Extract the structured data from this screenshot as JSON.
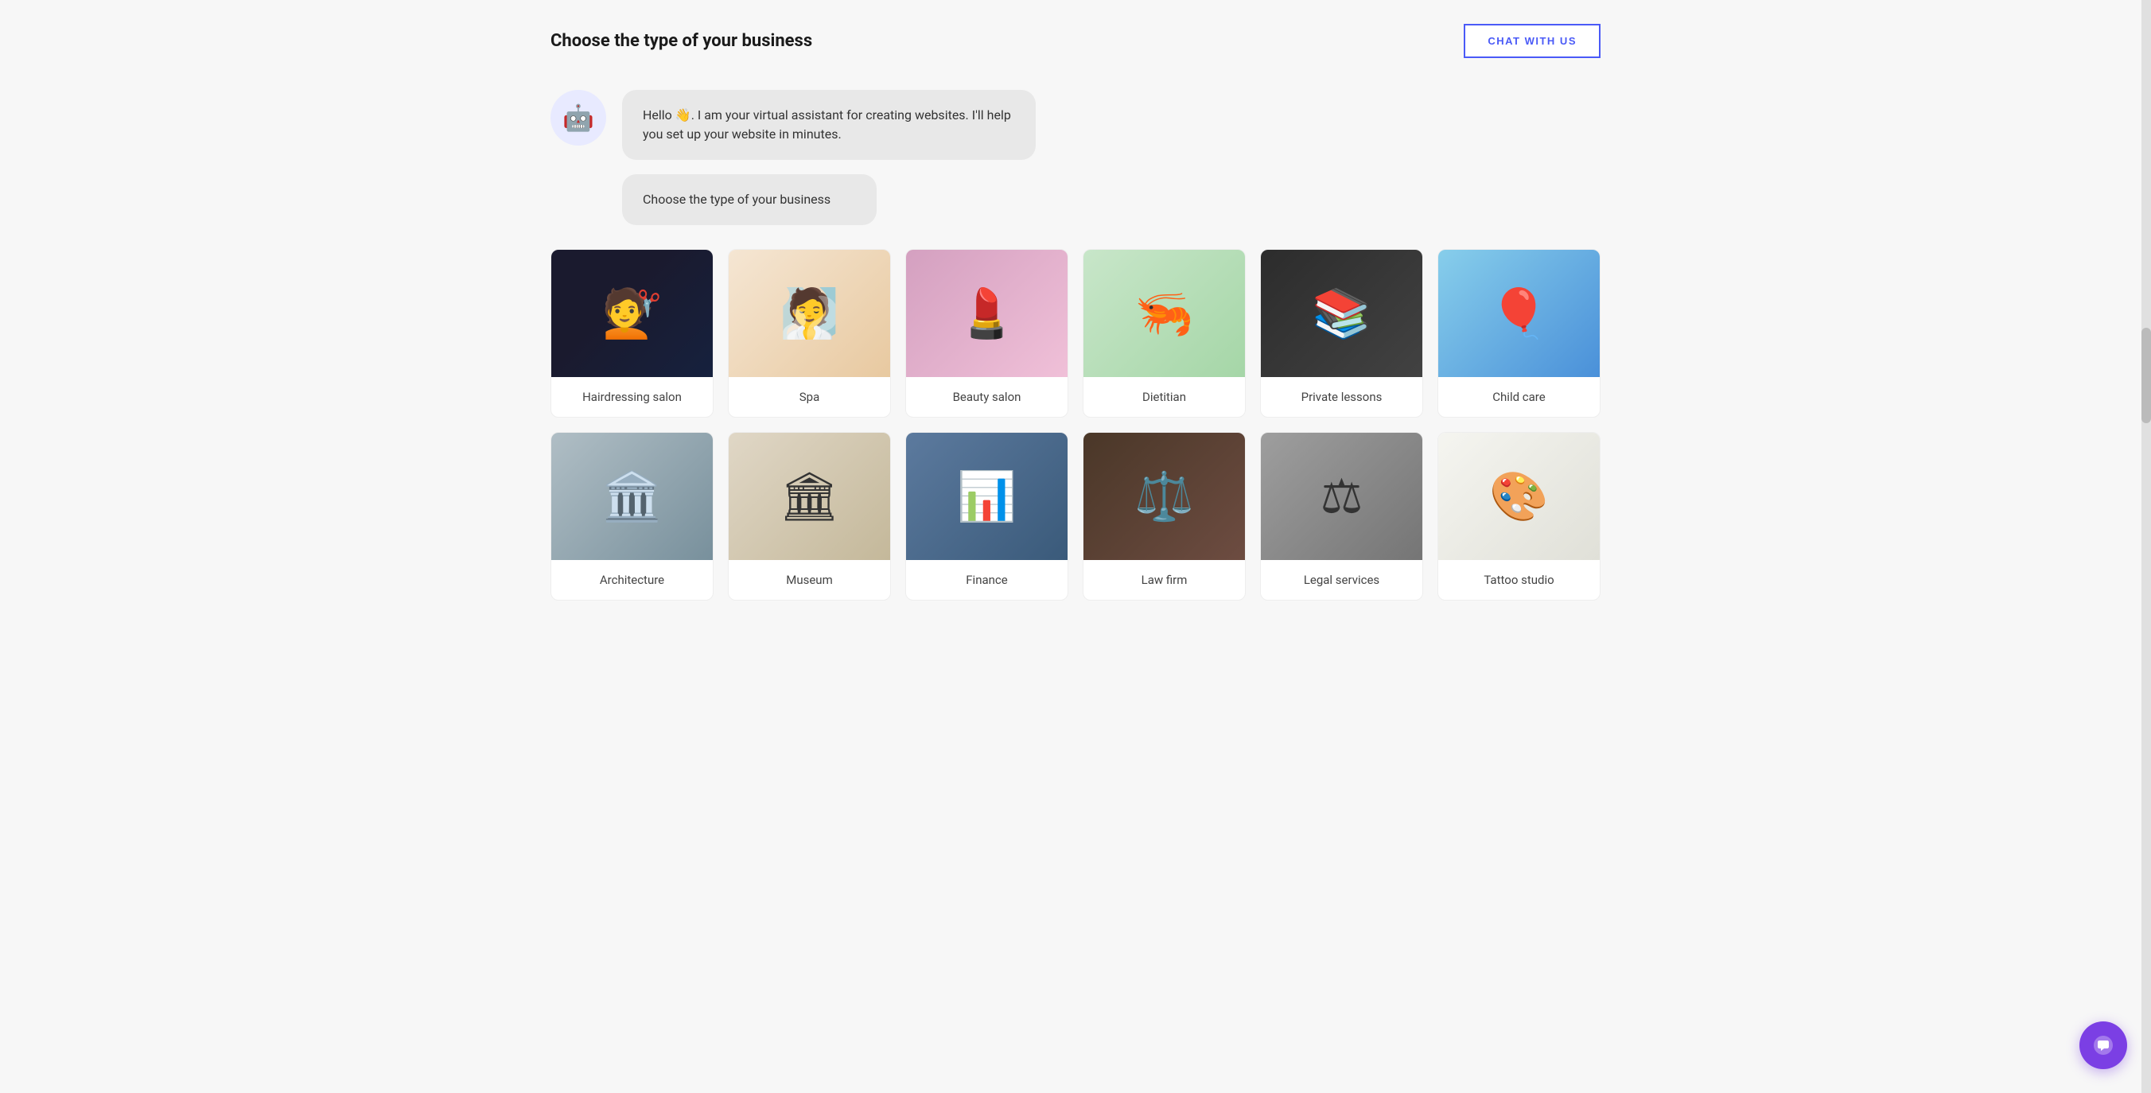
{
  "header": {
    "title": "Choose the type of your business",
    "chat_btn_label": "CHAT WITH US"
  },
  "bot": {
    "greeting_message": "Hello 👋. I am your virtual assistant for creating websites. I'll help you set up your website in minutes.",
    "prompt_message": "Choose the type of your business"
  },
  "business_types": [
    {
      "id": "hairdressing",
      "label": "Hairdressing salon",
      "img_class": "img-hairdressing"
    },
    {
      "id": "spa",
      "label": "Spa",
      "img_class": "img-spa"
    },
    {
      "id": "beauty",
      "label": "Beauty salon",
      "img_class": "img-beauty"
    },
    {
      "id": "dietitian",
      "label": "Dietitian",
      "img_class": "img-dietitian"
    },
    {
      "id": "private",
      "label": "Private lessons",
      "img_class": "img-private"
    },
    {
      "id": "childcare",
      "label": "Child care",
      "img_class": "img-childcare"
    },
    {
      "id": "architecture",
      "label": "Architecture",
      "img_class": "img-architecture"
    },
    {
      "id": "museum",
      "label": "Museum",
      "img_class": "img-museum"
    },
    {
      "id": "finance",
      "label": "Finance",
      "img_class": "img-finance"
    },
    {
      "id": "law",
      "label": "Law firm",
      "img_class": "img-law"
    },
    {
      "id": "justice",
      "label": "Legal services",
      "img_class": "img-justice"
    },
    {
      "id": "tattoo",
      "label": "Tattoo studio",
      "img_class": "img-tattoo"
    }
  ]
}
